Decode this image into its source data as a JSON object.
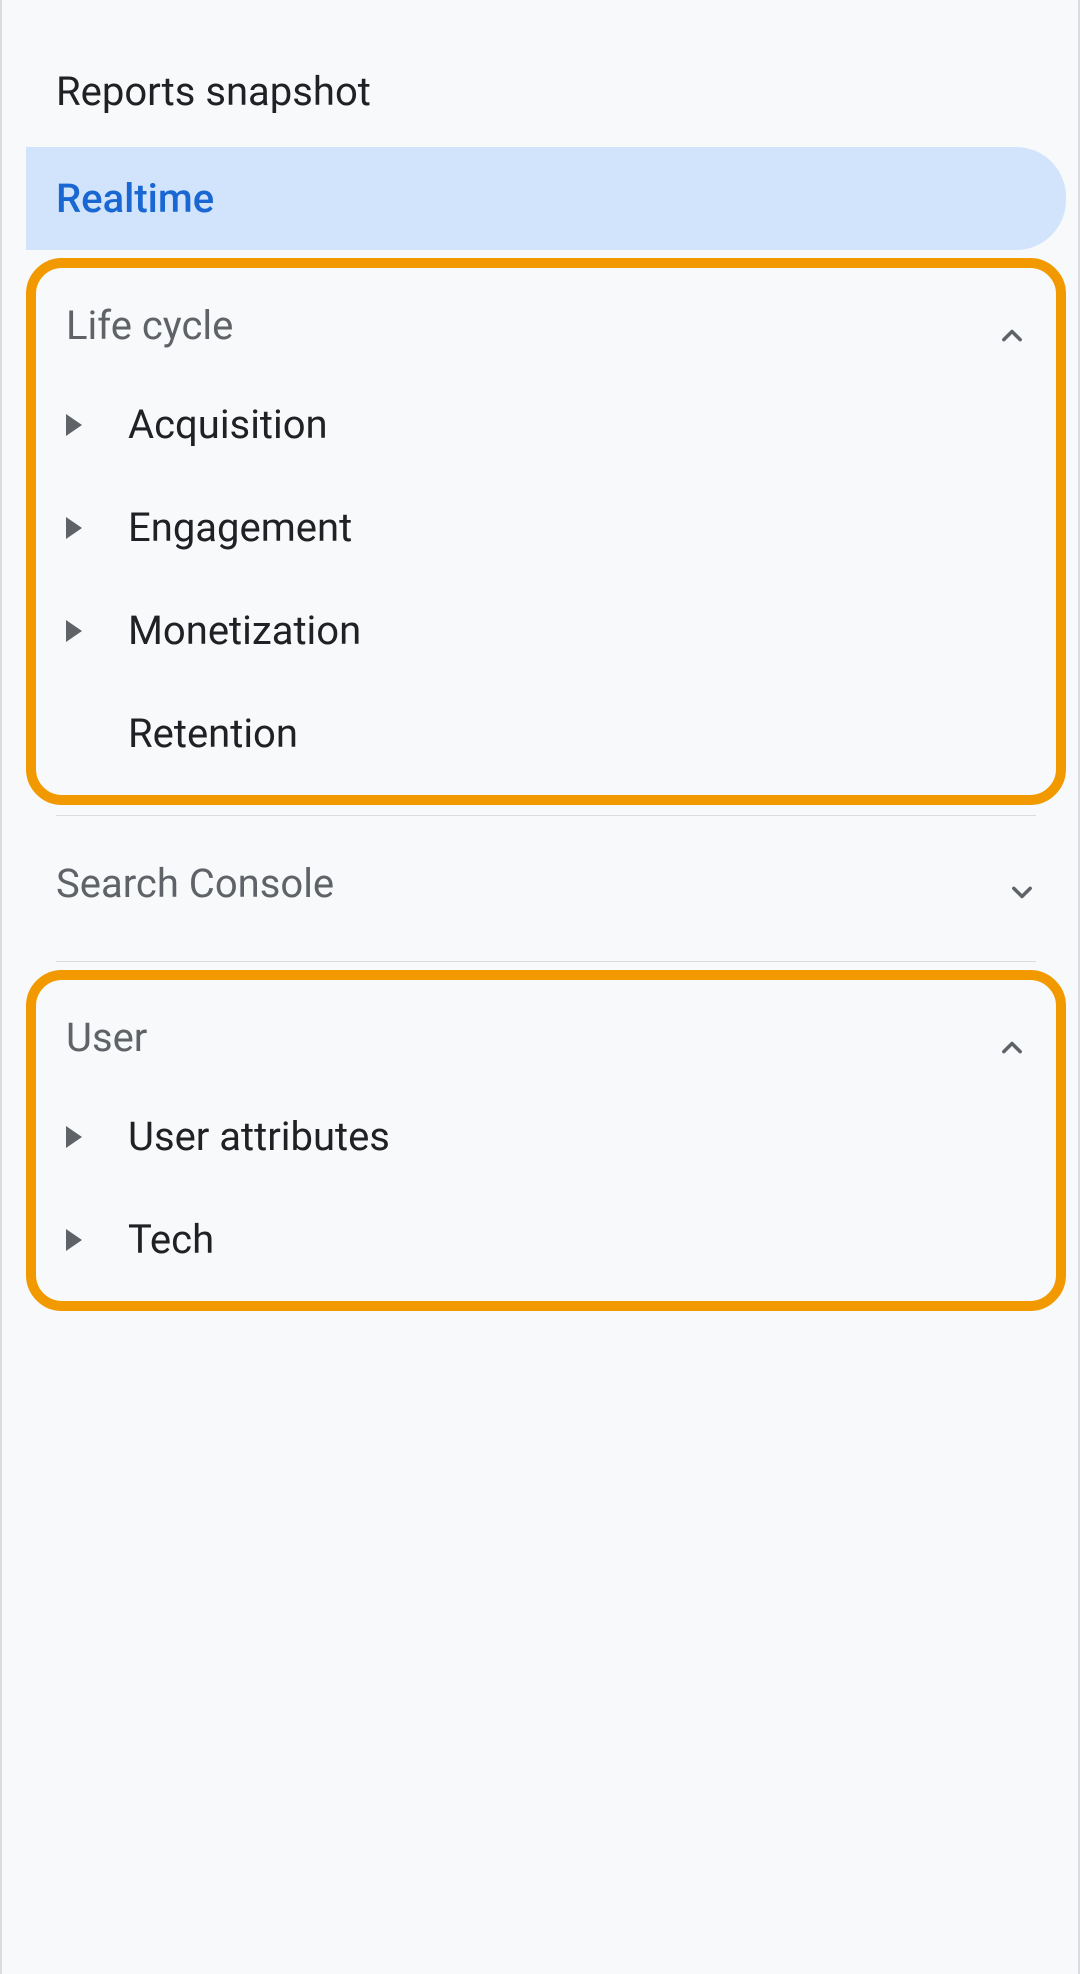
{
  "nav": {
    "reports_snapshot": "Reports snapshot",
    "realtime": "Realtime"
  },
  "sections": {
    "lifecycle": {
      "title": "Life cycle",
      "items": {
        "acquisition": "Acquisition",
        "engagement": "Engagement",
        "monetization": "Monetization",
        "retention": "Retention"
      }
    },
    "search_console": {
      "title": "Search Console"
    },
    "user": {
      "title": "User",
      "items": {
        "user_attributes": "User attributes",
        "tech": "Tech"
      }
    }
  }
}
